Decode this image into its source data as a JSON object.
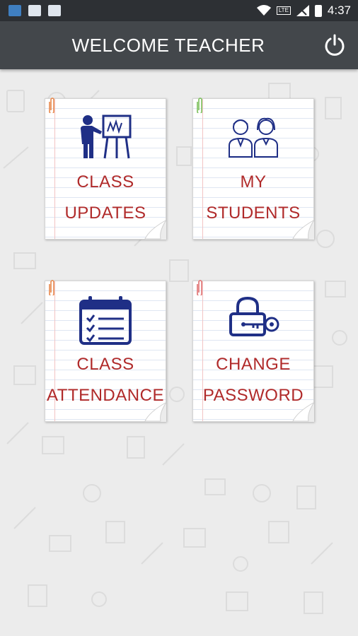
{
  "status_bar": {
    "time": "4:37",
    "network_label": "LTE",
    "left_icons": [
      "app-icon",
      "image-icon",
      "activity-icon"
    ],
    "right_icons": [
      "wifi-icon",
      "signal-icon",
      "battery-icon"
    ]
  },
  "header": {
    "title": "WELCOME TEACHER",
    "power_icon": "power-icon"
  },
  "menu": [
    {
      "id": "class-updates",
      "line1": "CLASS",
      "line2": "UPDATES",
      "icon": "teacher-board-icon",
      "clip_color": "#e8874a"
    },
    {
      "id": "my-students",
      "line1": "MY",
      "line2": "STUDENTS",
      "icon": "students-icon",
      "clip_color": "#7bbf5a"
    },
    {
      "id": "class-attendance",
      "line1": "CLASS",
      "line2": "ATTENDANCE",
      "icon": "calendar-checklist-icon",
      "clip_color": "#e8874a"
    },
    {
      "id": "change-password",
      "line1": "CHANGE",
      "line2": "PASSWORD",
      "icon": "lock-key-icon",
      "clip_color": "#e07070"
    }
  ],
  "colors": {
    "appbar": "#43474b",
    "statusbar": "#2d3034",
    "label_red": "#b02a2a",
    "icon_navy": "#1f2f86",
    "background": "#ececec"
  }
}
